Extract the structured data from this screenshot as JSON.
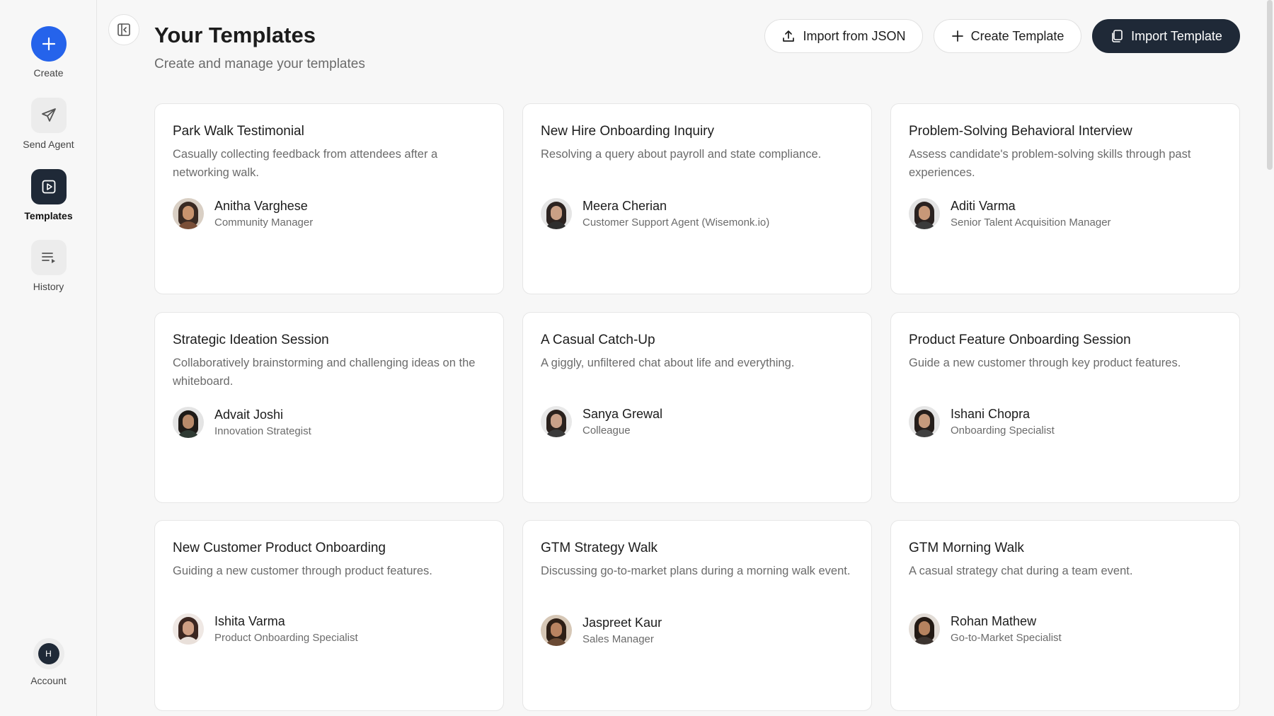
{
  "sidebar": {
    "items": [
      {
        "label": "Create",
        "icon": "plus-icon"
      },
      {
        "label": "Send Agent",
        "icon": "send-icon"
      },
      {
        "label": "Templates",
        "icon": "play-square-icon"
      },
      {
        "label": "History",
        "icon": "list-play-icon"
      }
    ],
    "account": {
      "label": "Account",
      "initial": "H"
    }
  },
  "header": {
    "title": "Your Templates",
    "subtitle": "Create and manage your templates",
    "buttons": {
      "import_json": "Import from JSON",
      "create_template": "Create Template",
      "import_template": "Import Template"
    }
  },
  "colors": {
    "accent": "#2563eb",
    "dark": "#1f2937",
    "background": "#f7f7f7",
    "card": "#ffffff"
  },
  "templates": [
    {
      "title": "Park Walk Testimonial",
      "description": "Casually collecting feedback from attendees after a networking walk.",
      "person": "Anitha Varghese",
      "role": "Community Manager"
    },
    {
      "title": "New Hire Onboarding Inquiry",
      "description": "Resolving a query about payroll and state compliance.",
      "person": "Meera Cherian",
      "role": "Customer Support Agent (Wisemonk.io)"
    },
    {
      "title": "Problem-Solving Behavioral Interview",
      "description": "Assess candidate's problem-solving skills through past experiences.",
      "person": "Aditi Varma",
      "role": "Senior Talent Acquisition Manager"
    },
    {
      "title": "Strategic Ideation Session",
      "description": "Collaboratively brainstorming and challenging ideas on the whiteboard.",
      "person": "Advait Joshi",
      "role": "Innovation Strategist"
    },
    {
      "title": "A Casual Catch-Up",
      "description": "A giggly, unfiltered chat about life and everything.",
      "person": "Sanya Grewal",
      "role": "Colleague"
    },
    {
      "title": "Product Feature Onboarding Session",
      "description": "Guide a new customer through key product features.",
      "person": "Ishani Chopra",
      "role": "Onboarding Specialist"
    },
    {
      "title": "New Customer Product Onboarding",
      "description": "Guiding a new customer through product features.",
      "person": "Ishita Varma",
      "role": "Product Onboarding Specialist"
    },
    {
      "title": "GTM Strategy Walk",
      "description": "Discussing go-to-market plans during a morning walk event.",
      "person": "Jaspreet Kaur",
      "role": "Sales Manager"
    },
    {
      "title": "GTM Morning Walk",
      "description": "A casual strategy chat during a team event.",
      "person": "Rohan Mathew",
      "role": "Go-to-Market Specialist"
    }
  ]
}
